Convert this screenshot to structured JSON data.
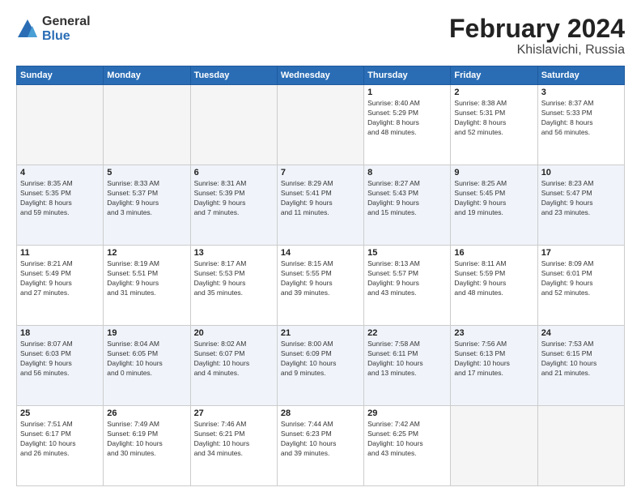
{
  "logo": {
    "general": "General",
    "blue": "Blue"
  },
  "title": {
    "month": "February 2024",
    "location": "Khislavichi, Russia"
  },
  "days_of_week": [
    "Sunday",
    "Monday",
    "Tuesday",
    "Wednesday",
    "Thursday",
    "Friday",
    "Saturday"
  ],
  "weeks": [
    [
      {
        "num": "",
        "info": ""
      },
      {
        "num": "",
        "info": ""
      },
      {
        "num": "",
        "info": ""
      },
      {
        "num": "",
        "info": ""
      },
      {
        "num": "1",
        "info": "Sunrise: 8:40 AM\nSunset: 5:29 PM\nDaylight: 8 hours\nand 48 minutes."
      },
      {
        "num": "2",
        "info": "Sunrise: 8:38 AM\nSunset: 5:31 PM\nDaylight: 8 hours\nand 52 minutes."
      },
      {
        "num": "3",
        "info": "Sunrise: 8:37 AM\nSunset: 5:33 PM\nDaylight: 8 hours\nand 56 minutes."
      }
    ],
    [
      {
        "num": "4",
        "info": "Sunrise: 8:35 AM\nSunset: 5:35 PM\nDaylight: 8 hours\nand 59 minutes."
      },
      {
        "num": "5",
        "info": "Sunrise: 8:33 AM\nSunset: 5:37 PM\nDaylight: 9 hours\nand 3 minutes."
      },
      {
        "num": "6",
        "info": "Sunrise: 8:31 AM\nSunset: 5:39 PM\nDaylight: 9 hours\nand 7 minutes."
      },
      {
        "num": "7",
        "info": "Sunrise: 8:29 AM\nSunset: 5:41 PM\nDaylight: 9 hours\nand 11 minutes."
      },
      {
        "num": "8",
        "info": "Sunrise: 8:27 AM\nSunset: 5:43 PM\nDaylight: 9 hours\nand 15 minutes."
      },
      {
        "num": "9",
        "info": "Sunrise: 8:25 AM\nSunset: 5:45 PM\nDaylight: 9 hours\nand 19 minutes."
      },
      {
        "num": "10",
        "info": "Sunrise: 8:23 AM\nSunset: 5:47 PM\nDaylight: 9 hours\nand 23 minutes."
      }
    ],
    [
      {
        "num": "11",
        "info": "Sunrise: 8:21 AM\nSunset: 5:49 PM\nDaylight: 9 hours\nand 27 minutes."
      },
      {
        "num": "12",
        "info": "Sunrise: 8:19 AM\nSunset: 5:51 PM\nDaylight: 9 hours\nand 31 minutes."
      },
      {
        "num": "13",
        "info": "Sunrise: 8:17 AM\nSunset: 5:53 PM\nDaylight: 9 hours\nand 35 minutes."
      },
      {
        "num": "14",
        "info": "Sunrise: 8:15 AM\nSunset: 5:55 PM\nDaylight: 9 hours\nand 39 minutes."
      },
      {
        "num": "15",
        "info": "Sunrise: 8:13 AM\nSunset: 5:57 PM\nDaylight: 9 hours\nand 43 minutes."
      },
      {
        "num": "16",
        "info": "Sunrise: 8:11 AM\nSunset: 5:59 PM\nDaylight: 9 hours\nand 48 minutes."
      },
      {
        "num": "17",
        "info": "Sunrise: 8:09 AM\nSunset: 6:01 PM\nDaylight: 9 hours\nand 52 minutes."
      }
    ],
    [
      {
        "num": "18",
        "info": "Sunrise: 8:07 AM\nSunset: 6:03 PM\nDaylight: 9 hours\nand 56 minutes."
      },
      {
        "num": "19",
        "info": "Sunrise: 8:04 AM\nSunset: 6:05 PM\nDaylight: 10 hours\nand 0 minutes."
      },
      {
        "num": "20",
        "info": "Sunrise: 8:02 AM\nSunset: 6:07 PM\nDaylight: 10 hours\nand 4 minutes."
      },
      {
        "num": "21",
        "info": "Sunrise: 8:00 AM\nSunset: 6:09 PM\nDaylight: 10 hours\nand 9 minutes."
      },
      {
        "num": "22",
        "info": "Sunrise: 7:58 AM\nSunset: 6:11 PM\nDaylight: 10 hours\nand 13 minutes."
      },
      {
        "num": "23",
        "info": "Sunrise: 7:56 AM\nSunset: 6:13 PM\nDaylight: 10 hours\nand 17 minutes."
      },
      {
        "num": "24",
        "info": "Sunrise: 7:53 AM\nSunset: 6:15 PM\nDaylight: 10 hours\nand 21 minutes."
      }
    ],
    [
      {
        "num": "25",
        "info": "Sunrise: 7:51 AM\nSunset: 6:17 PM\nDaylight: 10 hours\nand 26 minutes."
      },
      {
        "num": "26",
        "info": "Sunrise: 7:49 AM\nSunset: 6:19 PM\nDaylight: 10 hours\nand 30 minutes."
      },
      {
        "num": "27",
        "info": "Sunrise: 7:46 AM\nSunset: 6:21 PM\nDaylight: 10 hours\nand 34 minutes."
      },
      {
        "num": "28",
        "info": "Sunrise: 7:44 AM\nSunset: 6:23 PM\nDaylight: 10 hours\nand 39 minutes."
      },
      {
        "num": "29",
        "info": "Sunrise: 7:42 AM\nSunset: 6:25 PM\nDaylight: 10 hours\nand 43 minutes."
      },
      {
        "num": "",
        "info": ""
      },
      {
        "num": "",
        "info": ""
      }
    ]
  ]
}
